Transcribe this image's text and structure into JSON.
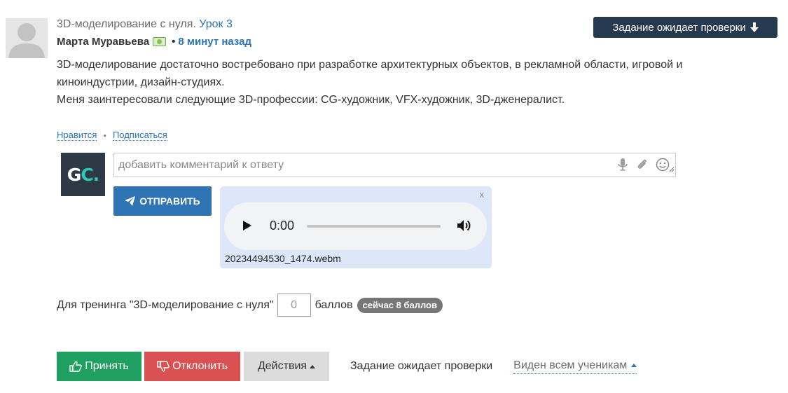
{
  "header": {
    "course_title": "3D-моделирование с нуля.",
    "lesson_link": "Урок 3",
    "author_name": "Марта Муравьева",
    "separator": "•",
    "time_ago": "8 минут назад",
    "status_pill": "Задание ожидает проверки"
  },
  "answer": {
    "paragraph1": "3D-моделирование достаточно востребовано при разработке архитектурных объектов, в рекламной области, игровой и киноиндустрии, дизайн-студиях.",
    "paragraph2": "Меня заинтересовали следующие 3D-профессии: CG-художник, VFX-художник, 3D-дженералист."
  },
  "actions": {
    "like": "Нравится",
    "separator": "•",
    "subscribe": "Подписаться"
  },
  "comment": {
    "avatar_text_main": "G",
    "avatar_text_accent": "C.",
    "placeholder": "добавить комментарий к ответу",
    "send_label": "ОТПРАВИТЬ"
  },
  "audio": {
    "close": "x",
    "time": "0:00",
    "filename": "20234494530_1474.webm"
  },
  "score": {
    "label": "Для тренинга \"3D-моделирование с нуля\"",
    "value": "0",
    "unit": "баллов",
    "current_badge": "сейчас 8 баллов"
  },
  "bottom": {
    "accept": "Принять",
    "reject": "Отклонить",
    "actions": "Действия",
    "status": "Задание ожидает проверки",
    "visibility": "Виден всем ученикам"
  },
  "colors": {
    "link": "#2a74b8",
    "status_pill_bg": "#26394d",
    "accept_bg": "#20a060",
    "reject_bg": "#db5050",
    "send_bg": "#2f74b5",
    "audio_card_bg": "#dde7f9",
    "gc_avatar_bg": "#2d3a45",
    "gc_accent": "#2fc7b6"
  }
}
